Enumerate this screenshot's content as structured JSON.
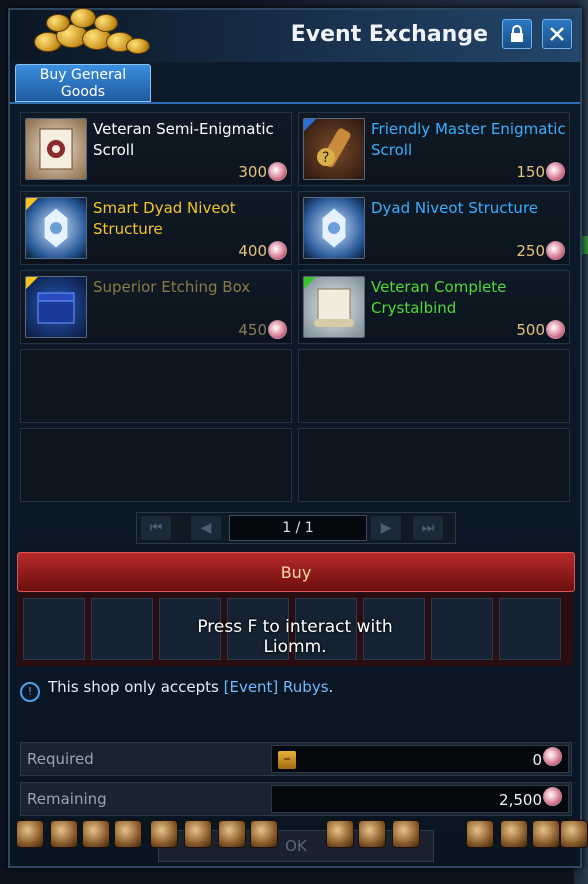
{
  "window": {
    "title": "Event Exchange",
    "lock_icon": "lock-icon",
    "close_icon": "close-icon"
  },
  "tab": {
    "label": "Buy General Goods"
  },
  "items": [
    {
      "name": "Veteran Semi-Enigmatic Scroll",
      "price": "300",
      "color": "#ffffff",
      "grade_corner": "",
      "icon": "scroll-gear-icon"
    },
    {
      "name": "Friendly Master Enigmatic Scroll",
      "price": "150",
      "color": "#3aaeff",
      "grade_corner": "#2a6ed8",
      "icon": "enigmatic-scroll-icon"
    },
    {
      "name": "Smart Dyad Niveot Structure",
      "price": "400",
      "color": "#f6c42a",
      "grade_corner": "#f4c41b",
      "icon": "niveot-structure-icon"
    },
    {
      "name": "Dyad Niveot Structure",
      "price": "250",
      "color": "#3aaeff",
      "grade_corner": "",
      "icon": "niveot-structure-icon"
    },
    {
      "name": "Superior Etching Box",
      "price": "450",
      "color": "#8a7a44",
      "grade_corner": "#f4c41b",
      "icon": "etching-box-icon"
    },
    {
      "name": "Veteran Complete Crystalbind",
      "price": "500",
      "color": "#4edb3a",
      "grade_corner": "#37c52a",
      "icon": "crystalbind-scroll-icon"
    }
  ],
  "pager": {
    "label": "1 / 1"
  },
  "buy": {
    "label": "Buy",
    "prompt": "Press F to interact with Liomm."
  },
  "info": {
    "text": "This shop only accepts ",
    "highlight": "[Event] Rubys",
    "suffix": "."
  },
  "required": {
    "label": "Required",
    "value": "0"
  },
  "remaining": {
    "label": "Remaining",
    "value": "2,500"
  },
  "ok": {
    "label": "OK"
  }
}
